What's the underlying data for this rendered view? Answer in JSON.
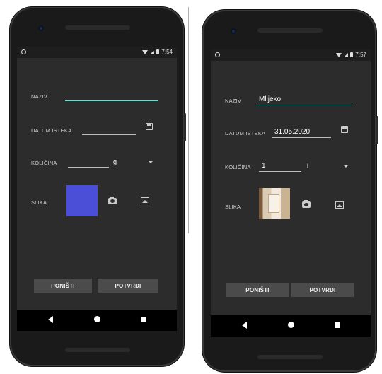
{
  "left": {
    "status_time": "7:54",
    "labels": {
      "naziv": "NAZIV",
      "datum": "DATUM ISTEKA",
      "kolicina": "KOLIČINA",
      "slika": "SLIKA"
    },
    "values": {
      "naziv": "",
      "datum": "",
      "kolicina": "",
      "unit": "g"
    },
    "image_color": "#4b4fd8",
    "buttons": {
      "cancel": "PONIŠTI",
      "confirm": "POTVRDI"
    }
  },
  "right": {
    "status_time": "7:57",
    "labels": {
      "naziv": "NAZIV",
      "datum": "DATUM ISTEKA",
      "kolicina": "KOLIČINA",
      "slika": "SLIKA"
    },
    "values": {
      "naziv": "Mlijeko",
      "datum": "31.05.2020",
      "kolicina": "1",
      "unit": "l"
    },
    "buttons": {
      "cancel": "PONIŠTI",
      "confirm": "POTVRDI"
    }
  },
  "colors": {
    "accent": "#7fd5c9",
    "screen_bg": "#2c2c2c",
    "button_bg": "#4b4b4b"
  },
  "icons": [
    "calendar-icon",
    "camera-icon",
    "gallery-icon",
    "dropdown-caret-icon",
    "nav-back-icon",
    "nav-home-icon",
    "nav-recents-icon"
  ]
}
